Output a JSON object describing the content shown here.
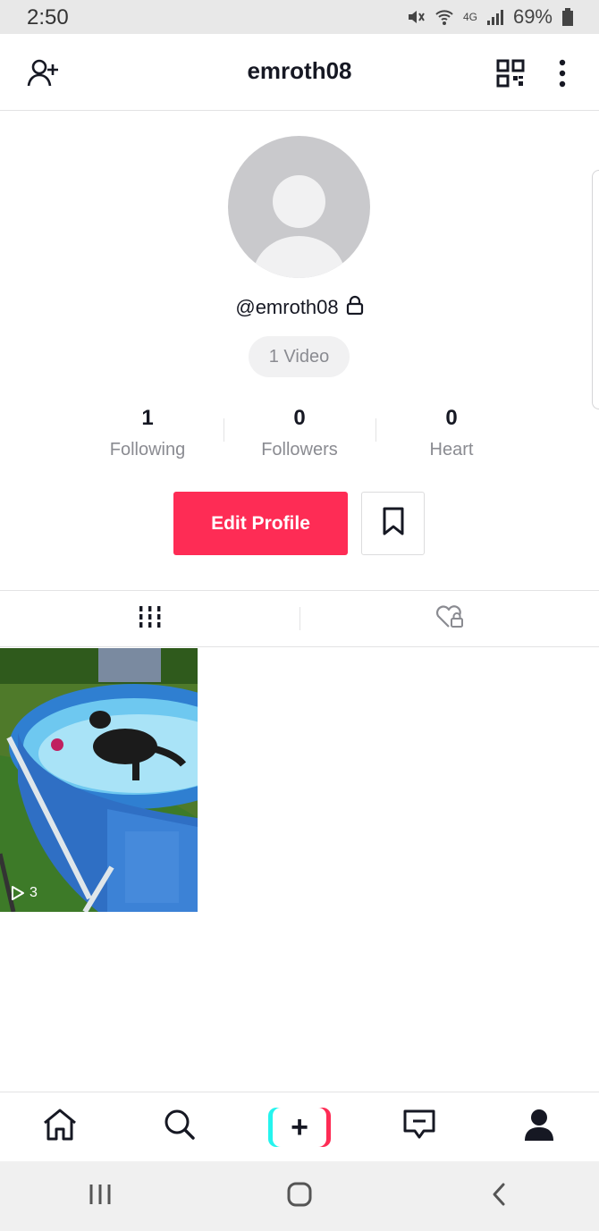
{
  "status_bar": {
    "time": "2:50",
    "network": "4G",
    "battery": "69%"
  },
  "header": {
    "title": "emroth08",
    "icons": [
      "add-user-icon",
      "qr-code-icon",
      "more-options-icon"
    ]
  },
  "profile": {
    "handle": "@emroth08",
    "private_icon": "lock-icon",
    "video_count_label": "1 Video",
    "stats": [
      {
        "value": "1",
        "label": "Following"
      },
      {
        "value": "0",
        "label": "Followers"
      },
      {
        "value": "0",
        "label": "Heart"
      }
    ],
    "edit_button_label": "Edit Profile",
    "bookmark_icon": "bookmark-icon"
  },
  "tabs": [
    {
      "icon": "grid-icon",
      "active": true
    },
    {
      "icon": "liked-locked-icon",
      "active": false
    }
  ],
  "videos": [
    {
      "views": "3",
      "description": "dog in above-ground pool"
    }
  ],
  "bottom_nav": {
    "items": [
      "home-icon",
      "discover-icon",
      "create-icon",
      "inbox-icon",
      "profile-icon"
    ]
  },
  "system_nav": [
    "recents-icon",
    "home-circle-icon",
    "back-icon"
  ],
  "colors": {
    "accent": "#fe2c55",
    "cyan": "#25f4ee",
    "text_primary": "#161823",
    "text_secondary": "#8a8b91"
  }
}
